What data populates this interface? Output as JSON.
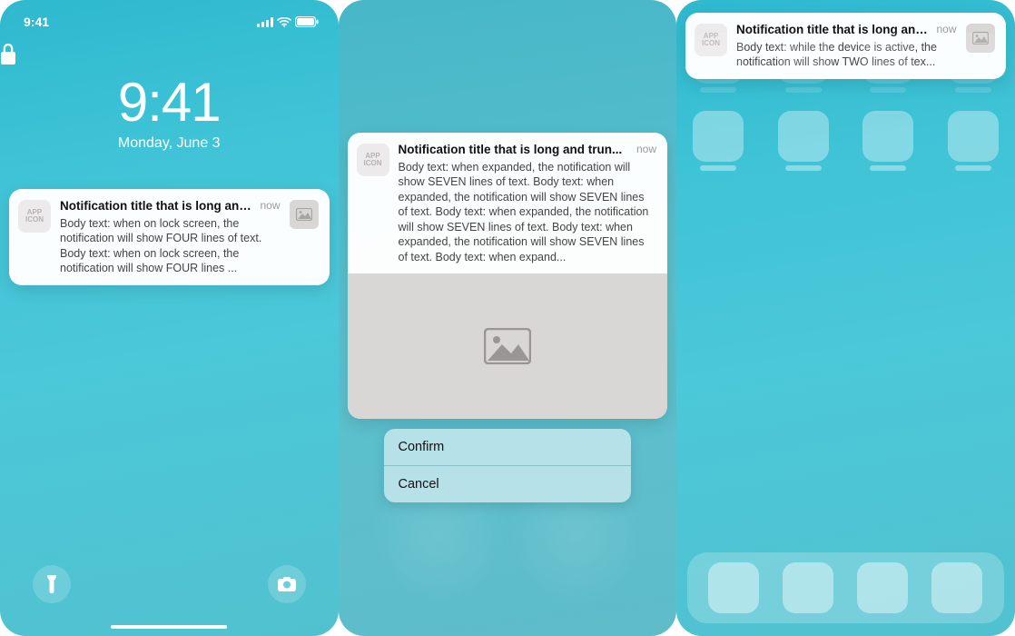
{
  "statusbar": {
    "time": "9:41"
  },
  "lockscreen": {
    "big_time": "9:41",
    "date": "Monday, June 3",
    "notif": {
      "app_icon_label": "APP\nICON",
      "title": "Notification title that is long and trun...",
      "time": "now",
      "body": "Body text: when on lock screen, the notification will show FOUR lines of text. Body text: when on lock screen, the notification will show FOUR lines ..."
    }
  },
  "expanded": {
    "notif": {
      "app_icon_label": "APP\nICON",
      "title": "Notification title that is long and trun...",
      "time": "now",
      "body": "Body text: when expanded, the notification will show SEVEN lines of text. Body text: when expanded, the notification will show SEVEN lines of text. Body text: when expanded, the notification will show SEVEN lines of text. Body text: when expanded, the notification will show SEVEN lines of text. Body text: when expand..."
    },
    "actions": {
      "confirm": "Confirm",
      "cancel": "Cancel"
    }
  },
  "homescreen": {
    "notif": {
      "app_icon_label": "APP\nICON",
      "title": "Notification title that is long and trun...",
      "time": "now",
      "body": "Body text: while the device is active, the notification will show TWO lines of tex..."
    }
  }
}
